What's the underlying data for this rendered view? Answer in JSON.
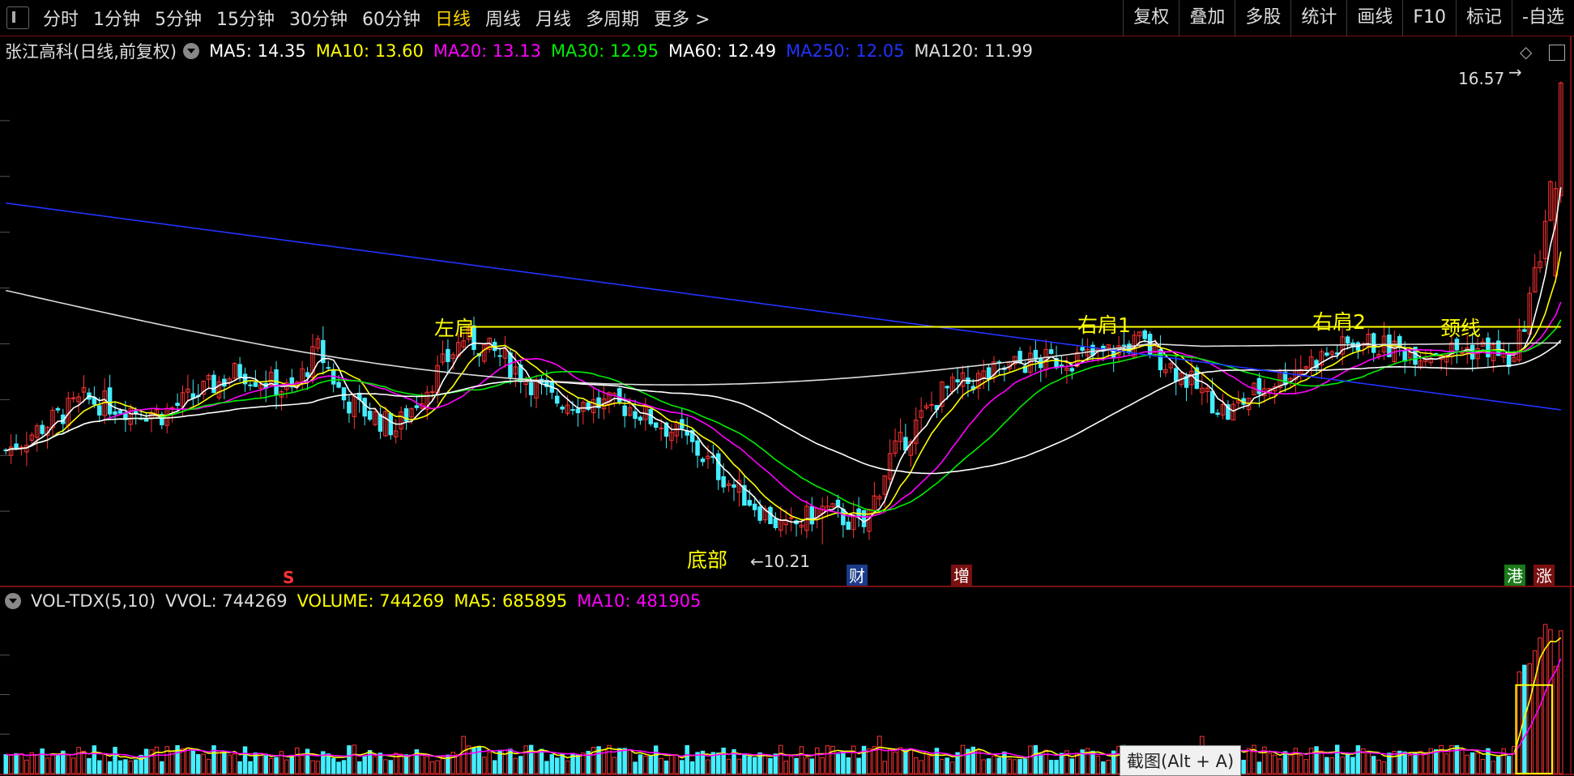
{
  "toolbar": {
    "periods": [
      "分时",
      "1分钟",
      "5分钟",
      "15分钟",
      "30分钟",
      "60分钟",
      "日线",
      "周线",
      "月线",
      "多周期",
      "更多 >"
    ],
    "active_period": "日线",
    "tools": [
      "复权",
      "叠加",
      "多股",
      "统计",
      "画线",
      "F10",
      "标记",
      "-自选"
    ]
  },
  "legend": {
    "title": "张江高科(日线,前复权)",
    "ma5": "MA5: 14.35",
    "ma10": "MA10: 13.60",
    "ma20": "MA20: 13.13",
    "ma30": "MA30: 12.95",
    "ma60": "MA60: 12.49",
    "ma250": "MA250: 12.05",
    "ma120": "MA120: 11.99"
  },
  "colors": {
    "up": "#ff3333",
    "down": "#44eeff",
    "ma5": "#ffffff",
    "ma10": "#ffff00",
    "ma20": "#ff00ff",
    "ma30": "#00ee00",
    "ma60": "#ffffff",
    "ma250": "#2233ff",
    "ma120": "#dddddd",
    "neckline": "#ffff00",
    "frame": "#7a1010"
  },
  "annotations": {
    "left_shoulder": "左肩",
    "right_shoulder_1": "右肩1",
    "right_shoulder_2": "右肩2",
    "neckline": "颈线",
    "bottom": "底部",
    "low_price": "←10.21",
    "high_price": "16.57",
    "high_arrow": "→"
  },
  "markers": {
    "s_marker": "S",
    "cai": "财",
    "zeng": "增",
    "gang": "港",
    "zhang": "涨"
  },
  "volume_legend": {
    "title": "VOL-TDX(5,10)",
    "vvol": "VVOL: 744269",
    "volume": "VOLUME: 744269",
    "ma5": "MA5: 685895",
    "ma10": "MA10: 481905"
  },
  "corner": {
    "diamond": "◇"
  },
  "screenshot_tip": "截图(Alt + A)",
  "chart_data": {
    "type": "candlestick",
    "title": "张江高科(日线,前复权)",
    "ylim": [
      9.9,
      16.8
    ],
    "low": 10.21,
    "high": 16.57,
    "neckline_price": 13.2,
    "ma_last": {
      "MA5": 14.35,
      "MA10": 13.6,
      "MA20": 13.13,
      "MA30": 12.95,
      "MA60": 12.49,
      "MA250": 12.05,
      "MA120": 11.99
    },
    "key_points": [
      {
        "label": "左肩",
        "x": 0.29,
        "price": 13.2
      },
      {
        "label": "底部",
        "x": 0.48,
        "price": 10.21
      },
      {
        "label": "右肩1",
        "x": 0.69,
        "price": 13.2
      },
      {
        "label": "右肩2",
        "x": 0.84,
        "price": 13.0
      },
      {
        "label": "high",
        "x": 0.985,
        "price": 16.57
      }
    ],
    "volume_last": 744269,
    "volume_ma5": 685895,
    "volume_ma10": 481905
  }
}
